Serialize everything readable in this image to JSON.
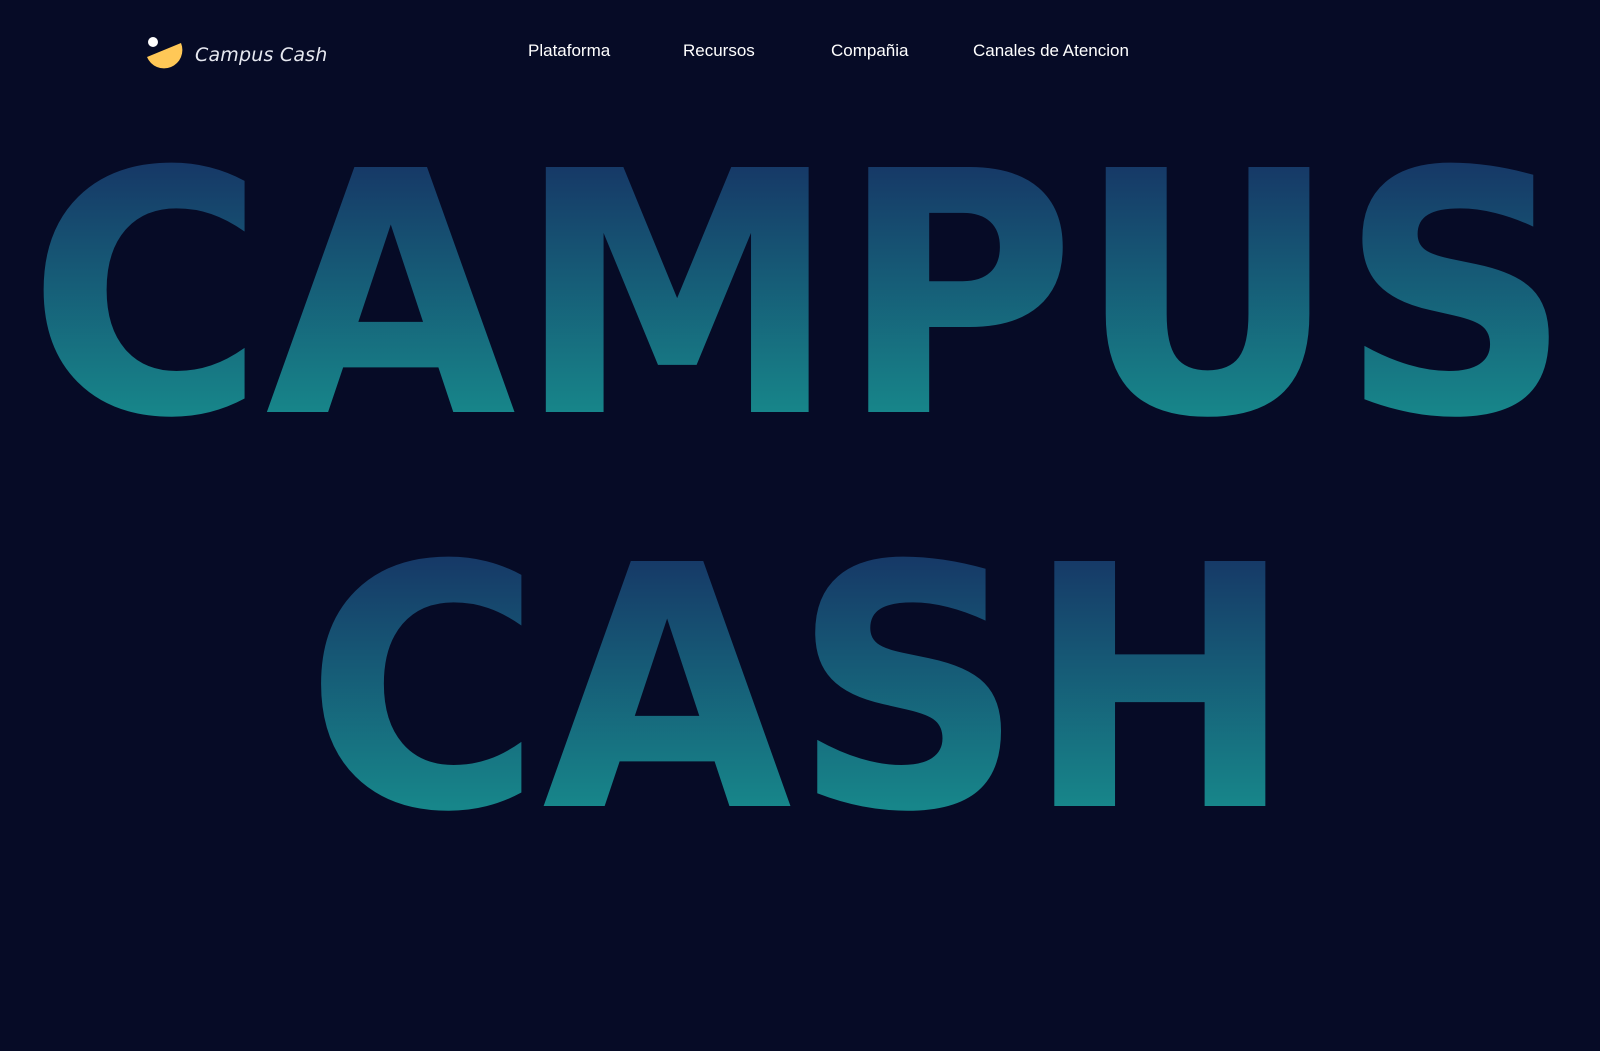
{
  "header": {
    "brand": "Campus Cash",
    "nav": [
      {
        "label": "Plataforma"
      },
      {
        "label": "Recursos"
      },
      {
        "label": "Compañia"
      },
      {
        "label": "Canales de Atencion"
      }
    ]
  },
  "hero": {
    "line1": "CAMPUS",
    "line2": "CASH"
  },
  "colors": {
    "background": "#060b26",
    "logo_accent": "#ffc857",
    "hero_gradient_top": "#163766",
    "hero_gradient_bottom": "#17868a"
  },
  "icons": {
    "logo": "campus-cash-logo-icon"
  }
}
